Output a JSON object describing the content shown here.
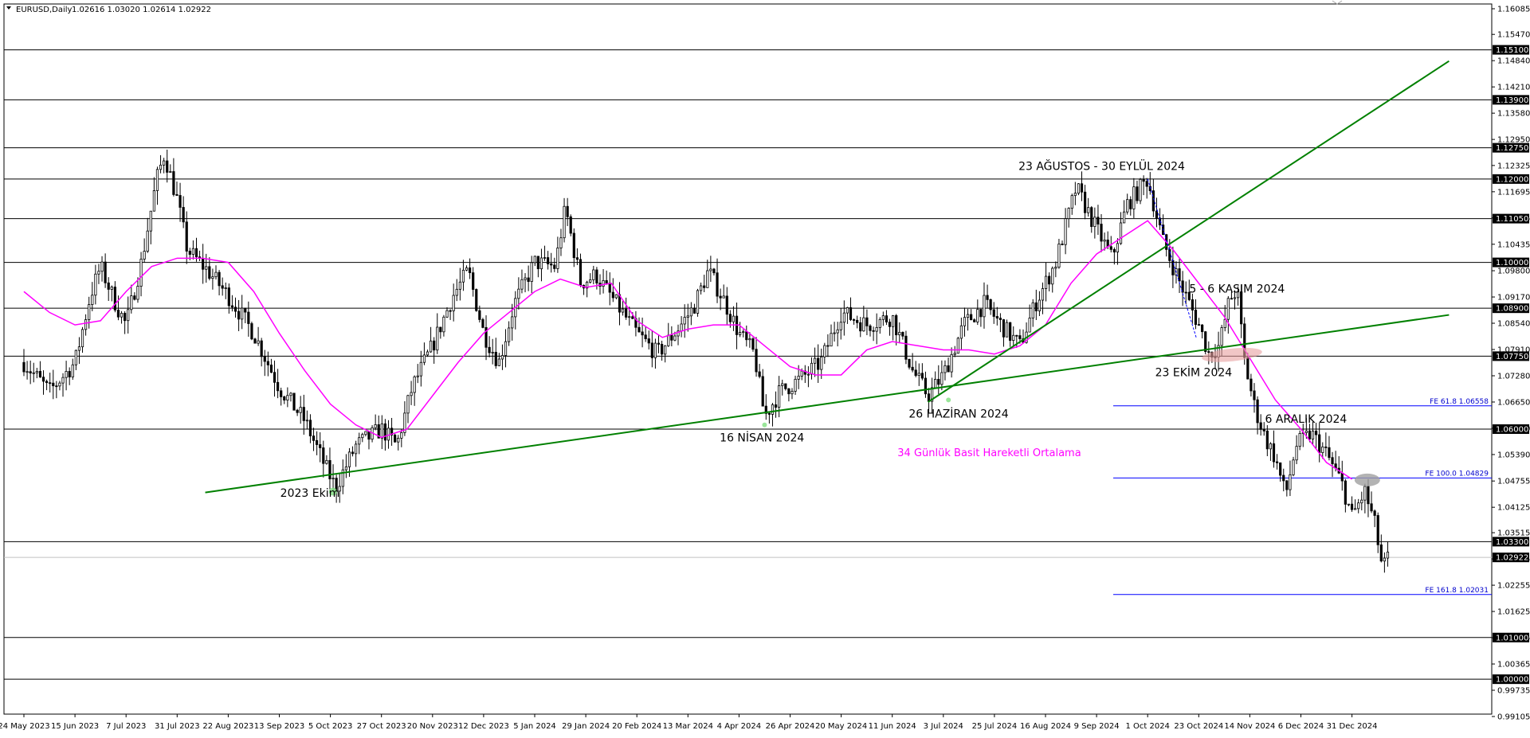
{
  "header": {
    "symbol": "EURUSD,Daily",
    "ohlc": "1.02616 1.03020 1.02614 1.02922"
  },
  "chart_data": {
    "type": "candlestick",
    "symbol": "EURUSD",
    "timeframe": "Daily",
    "ylim": [
      0.99105,
      1.16085
    ],
    "price_ticks": [
      "1.16085",
      "1.15470",
      "1.14840",
      "1.14210",
      "1.13580",
      "1.12950",
      "1.12325",
      "1.11695",
      "1.11065",
      "1.10435",
      "1.09800",
      "1.09170",
      "1.08540",
      "1.07910",
      "1.07280",
      "1.06650",
      "1.06020",
      "1.05390",
      "1.04755",
      "1.04125",
      "1.03515",
      "1.02885",
      "1.02255",
      "1.01625",
      "1.00995",
      "1.00365",
      "0.99735",
      "0.99105"
    ],
    "date_ticks": [
      "24 May 2023",
      "15 Jun 2023",
      "7 Jul 2023",
      "31 Jul 2023",
      "22 Aug 2023",
      "13 Sep 2023",
      "5 Oct 2023",
      "27 Oct 2023",
      "20 Nov 2023",
      "12 Dec 2023",
      "5 Jan 2024",
      "29 Jan 2024",
      "20 Feb 2024",
      "13 Mar 2024",
      "4 Apr 2024",
      "26 Apr 2024",
      "20 May 2024",
      "11 Jun 2024",
      "3 Jul 2024",
      "25 Jul 2024",
      "16 Aug 2024",
      "9 Sep 2024",
      "1 Oct 2024",
      "23 Oct 2024",
      "14 Nov 2024",
      "6 Dec 2024",
      "31 Dec 2024"
    ],
    "horizontal_levels": [
      {
        "price": 1.151,
        "label": "1.15100"
      },
      {
        "price": 1.139,
        "label": "1.13900"
      },
      {
        "price": 1.1275,
        "label": "1.12750"
      },
      {
        "price": 1.12,
        "label": "1.12000"
      },
      {
        "price": 1.1105,
        "label": "1.11050"
      },
      {
        "price": 1.1,
        "label": "1.10000"
      },
      {
        "price": 1.089,
        "label": "1.08900"
      },
      {
        "price": 1.0775,
        "label": "1.07750"
      },
      {
        "price": 1.06,
        "label": "1.06000"
      },
      {
        "price": 1.033,
        "label": "1.03300"
      },
      {
        "price": 1.01,
        "label": "1.01000"
      },
      {
        "price": 1.0,
        "label": "1.00000"
      }
    ],
    "current_price": {
      "price": 1.02922,
      "label": "1.02922"
    },
    "fibonacci": [
      {
        "price": 1.06558,
        "label": "FE 61.8 1.06558"
      },
      {
        "price": 1.04829,
        "label": "FE 100.0 1.04829"
      },
      {
        "price": 1.02031,
        "label": "FE 161.8 1.02031"
      }
    ],
    "trendlines": [
      {
        "from": [
          3.55,
          1.0448
        ],
        "to": [
          27.9,
          1.0874
        ]
      },
      {
        "from": [
          17.7,
          1.0665
        ],
        "to": [
          27.9,
          1.1483
        ]
      }
    ],
    "annotations": [
      {
        "text": "2023 Ekim",
        "x": 5.6,
        "price": 1.0438
      },
      {
        "text": "16 NİSAN 2024",
        "x": 14.45,
        "price": 1.057
      },
      {
        "text": "26 HAZİRAN 2024",
        "x": 18.3,
        "price": 1.0628
      },
      {
        "text": "23 AĞUSTOS - 30 EYLÜL 2024",
        "x": 21.1,
        "price": 1.1222
      },
      {
        "text": "5 - 6 KASIM 2024",
        "x": 23.75,
        "price": 1.0928
      },
      {
        "text": "23 EKİM 2024",
        "x": 22.9,
        "price": 1.0727
      },
      {
        "text": "6 ARALIK 2024",
        "x": 25.1,
        "price": 1.0615
      },
      {
        "text": "34 Günlük Basit Hareketli Ortalama",
        "x": 18.9,
        "price": 1.0535
      }
    ],
    "price_path": [
      [
        0.0,
        1.076
      ],
      [
        0.5,
        1.069
      ],
      [
        1.0,
        1.076
      ],
      [
        1.3,
        1.092
      ],
      [
        1.5,
        1.099
      ],
      [
        1.8,
        1.09
      ],
      [
        2.0,
        1.085
      ],
      [
        2.3,
        1.1
      ],
      [
        2.6,
        1.12
      ],
      [
        2.75,
        1.126
      ],
      [
        3.0,
        1.115
      ],
      [
        3.2,
        1.103
      ],
      [
        3.6,
        1.098
      ],
      [
        4.0,
        1.092
      ],
      [
        4.5,
        1.083
      ],
      [
        5.0,
        1.07
      ],
      [
        5.5,
        1.062
      ],
      [
        5.9,
        1.051
      ],
      [
        6.1,
        1.046
      ],
      [
        6.5,
        1.056
      ],
      [
        7.0,
        1.06
      ],
      [
        7.3,
        1.056
      ],
      [
        7.6,
        1.07
      ],
      [
        8.0,
        1.08
      ],
      [
        8.4,
        1.092
      ],
      [
        8.7,
        1.098
      ],
      [
        9.0,
        1.083
      ],
      [
        9.3,
        1.076
      ],
      [
        9.6,
        1.09
      ],
      [
        10.0,
        1.1
      ],
      [
        10.4,
        1.099
      ],
      [
        10.6,
        1.113
      ],
      [
        10.9,
        1.095
      ],
      [
        11.2,
        1.097
      ],
      [
        11.6,
        1.09
      ],
      [
        12.0,
        1.083
      ],
      [
        12.4,
        1.078
      ],
      [
        12.8,
        1.084
      ],
      [
        13.1,
        1.089
      ],
      [
        13.4,
        1.098
      ],
      [
        13.7,
        1.091
      ],
      [
        14.0,
        1.083
      ],
      [
        14.3,
        1.078
      ],
      [
        14.5,
        1.063
      ],
      [
        14.8,
        1.069
      ],
      [
        15.2,
        1.072
      ],
      [
        15.6,
        1.076
      ],
      [
        16.0,
        1.088
      ],
      [
        16.5,
        1.085
      ],
      [
        17.0,
        1.087
      ],
      [
        17.4,
        1.074
      ],
      [
        17.7,
        1.068
      ],
      [
        18.0,
        1.073
      ],
      [
        18.4,
        1.085
      ],
      [
        18.8,
        1.09
      ],
      [
        19.2,
        1.084
      ],
      [
        19.5,
        1.08
      ],
      [
        19.8,
        1.09
      ],
      [
        20.2,
        1.1
      ],
      [
        20.6,
        1.118
      ],
      [
        21.0,
        1.108
      ],
      [
        21.3,
        1.101
      ],
      [
        21.6,
        1.114
      ],
      [
        22.0,
        1.12
      ],
      [
        22.3,
        1.105
      ],
      [
        22.6,
        1.096
      ],
      [
        23.0,
        1.085
      ],
      [
        23.2,
        1.078
      ],
      [
        23.4,
        1.08
      ],
      [
        23.6,
        1.091
      ],
      [
        23.75,
        1.0935
      ],
      [
        23.9,
        1.076
      ],
      [
        24.1,
        1.065
      ],
      [
        24.3,
        1.058
      ],
      [
        24.5,
        1.053
      ],
      [
        24.7,
        1.044
      ],
      [
        24.9,
        1.056
      ],
      [
        25.2,
        1.059
      ],
      [
        25.5,
        1.054
      ],
      [
        25.8,
        1.047
      ],
      [
        26.0,
        1.039
      ],
      [
        26.25,
        1.045
      ],
      [
        26.45,
        1.037
      ],
      [
        26.6,
        1.0262
      ],
      [
        26.7,
        1.0292
      ]
    ],
    "sma34_path": [
      [
        0.0,
        1.093
      ],
      [
        0.5,
        1.088
      ],
      [
        1.0,
        1.085
      ],
      [
        1.5,
        1.086
      ],
      [
        2.0,
        1.093
      ],
      [
        2.5,
        1.099
      ],
      [
        3.0,
        1.101
      ],
      [
        3.5,
        1.101
      ],
      [
        4.0,
        1.1
      ],
      [
        4.5,
        1.093
      ],
      [
        5.0,
        1.083
      ],
      [
        5.5,
        1.074
      ],
      [
        6.0,
        1.066
      ],
      [
        6.5,
        1.061
      ],
      [
        7.0,
        1.058
      ],
      [
        7.5,
        1.06
      ],
      [
        8.0,
        1.068
      ],
      [
        8.5,
        1.076
      ],
      [
        9.0,
        1.083
      ],
      [
        9.5,
        1.088
      ],
      [
        10.0,
        1.093
      ],
      [
        10.5,
        1.096
      ],
      [
        11.0,
        1.094
      ],
      [
        11.5,
        1.095
      ],
      [
        12.0,
        1.086
      ],
      [
        12.5,
        1.082
      ],
      [
        13.0,
        1.084
      ],
      [
        13.5,
        1.085
      ],
      [
        14.0,
        1.085
      ],
      [
        14.5,
        1.08
      ],
      [
        15.0,
        1.075
      ],
      [
        15.5,
        1.073
      ],
      [
        16.0,
        1.073
      ],
      [
        16.5,
        1.079
      ],
      [
        17.0,
        1.081
      ],
      [
        17.5,
        1.08
      ],
      [
        18.0,
        1.079
      ],
      [
        18.5,
        1.079
      ],
      [
        19.0,
        1.078
      ],
      [
        19.5,
        1.08
      ],
      [
        20.0,
        1.085
      ],
      [
        20.5,
        1.095
      ],
      [
        21.0,
        1.102
      ],
      [
        21.5,
        1.106
      ],
      [
        22.0,
        1.11
      ],
      [
        22.5,
        1.103
      ],
      [
        23.0,
        1.095
      ],
      [
        23.5,
        1.087
      ],
      [
        24.0,
        1.077
      ],
      [
        24.5,
        1.067
      ],
      [
        25.0,
        1.06
      ],
      [
        25.5,
        1.052
      ],
      [
        26.0,
        1.048
      ]
    ]
  }
}
